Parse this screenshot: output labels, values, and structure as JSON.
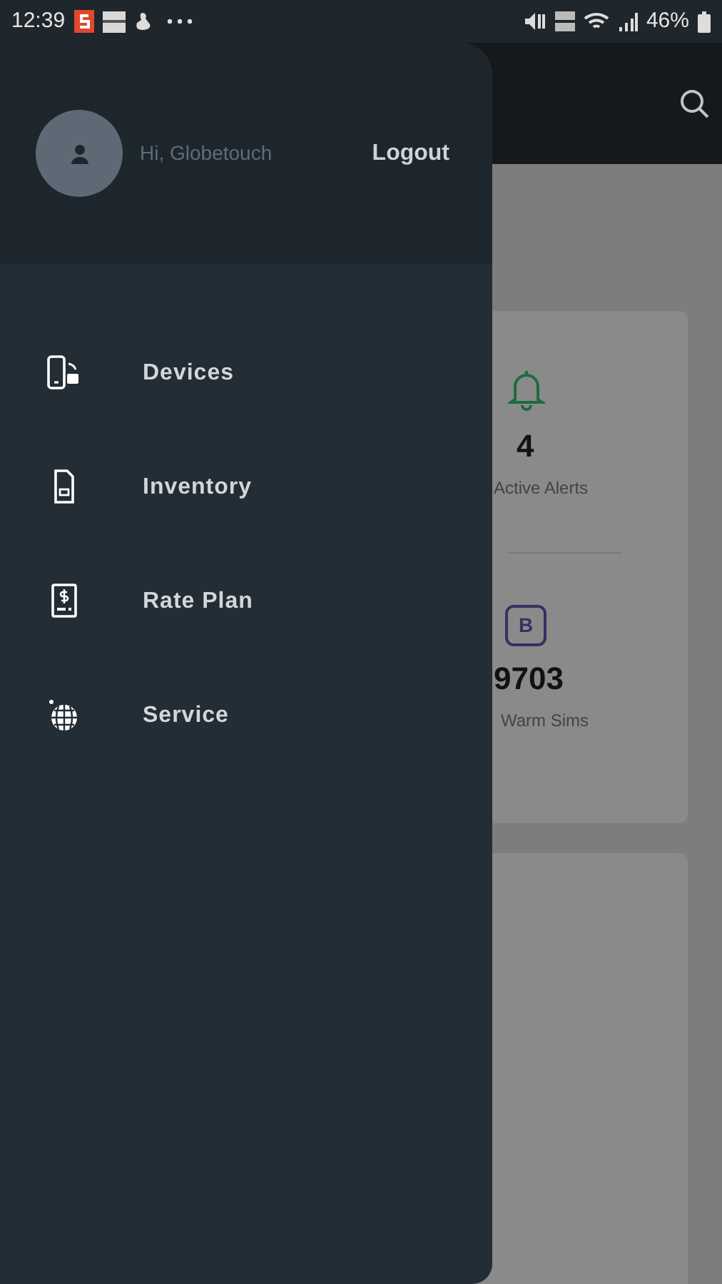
{
  "status_bar": {
    "time": "12:39",
    "battery": "46%"
  },
  "drawer": {
    "greeting": "Hi, Globetouch",
    "logout": "Logout",
    "items": [
      {
        "label": "Devices",
        "kind": "devices"
      },
      {
        "label": "Inventory",
        "kind": "sim"
      },
      {
        "label": "Rate Plan",
        "kind": "rate"
      },
      {
        "label": "Service",
        "kind": "globe"
      }
    ]
  },
  "dashboard": {
    "cards": [
      {
        "kind": "bell",
        "value": "4",
        "label": "Active Alerts"
      },
      {
        "kind": "badge",
        "badge": "B",
        "value": "9703",
        "label": "Warm Sims"
      }
    ]
  }
}
